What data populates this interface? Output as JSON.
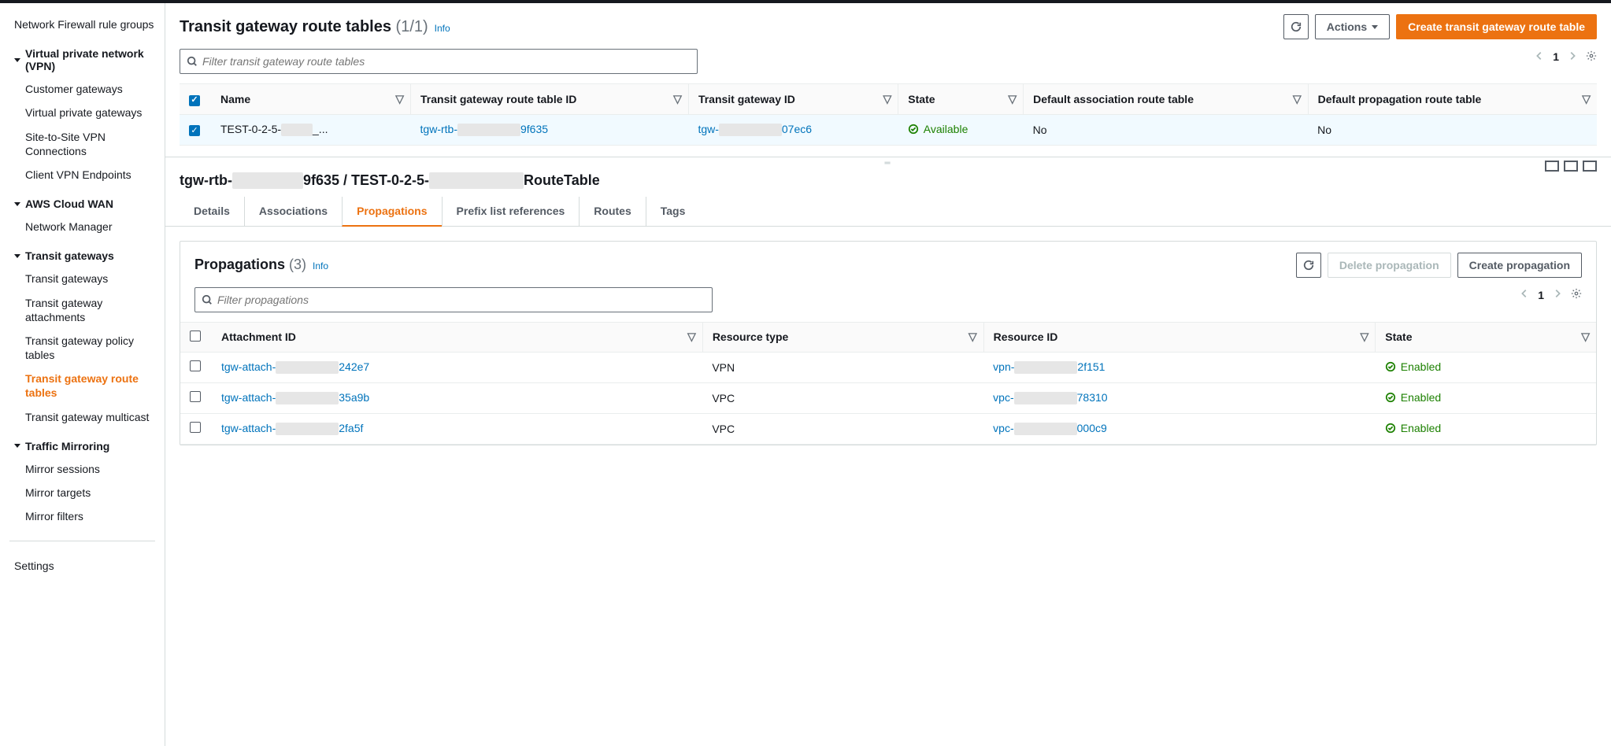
{
  "sidebar": {
    "top_items": [
      "Network Firewall rule groups"
    ],
    "groups": [
      {
        "title": "Virtual private network (VPN)",
        "items": [
          "Customer gateways",
          "Virtual private gateways",
          "Site-to-Site VPN Connections",
          "Client VPN Endpoints"
        ]
      },
      {
        "title": "AWS Cloud WAN",
        "items": [
          "Network Manager"
        ]
      },
      {
        "title": "Transit gateways",
        "items": [
          "Transit gateways",
          "Transit gateway attachments",
          "Transit gateway policy tables",
          "Transit gateway route tables",
          "Transit gateway multicast"
        ],
        "active_index": 3
      },
      {
        "title": "Traffic Mirroring",
        "items": [
          "Mirror sessions",
          "Mirror targets",
          "Mirror filters"
        ]
      }
    ],
    "footer": "Settings"
  },
  "header": {
    "title": "Transit gateway route tables",
    "count": "(1/1)",
    "info": "Info",
    "actions_label": "Actions",
    "create_label": "Create transit gateway route table",
    "filter_placeholder": "Filter transit gateway route tables",
    "page": "1"
  },
  "columns": [
    "Name",
    "Transit gateway route table ID",
    "Transit gateway ID",
    "State",
    "Default association route table",
    "Default propagation route table"
  ],
  "row": {
    "name_prefix": "TEST-0-2-5-",
    "name_suffix": "_...",
    "rtb_prefix": "tgw-rtb-",
    "rtb_suffix": "9f635",
    "tgw_prefix": "tgw-",
    "tgw_suffix": "07ec6",
    "state": "Available",
    "assoc": "No",
    "prop": "No"
  },
  "detail": {
    "breadcrumb_prefix": "tgw-rtb-",
    "breadcrumb_mid_suffix": "9f635 / TEST-0-2-5-",
    "breadcrumb_end": "RouteTable",
    "tabs": [
      "Details",
      "Associations",
      "Propagations",
      "Prefix list references",
      "Routes",
      "Tags"
    ],
    "active_tab": 2
  },
  "propagations": {
    "title": "Propagations",
    "count": "(3)",
    "info": "Info",
    "delete_label": "Delete propagation",
    "create_label": "Create propagation",
    "filter_placeholder": "Filter propagations",
    "page": "1",
    "columns": [
      "Attachment ID",
      "Resource type",
      "Resource ID",
      "State"
    ],
    "rows": [
      {
        "att_prefix": "tgw-attach-",
        "att_suffix": "242e7",
        "rtype": "VPN",
        "rid_prefix": "vpn-",
        "rid_suffix": "2f151",
        "state": "Enabled"
      },
      {
        "att_prefix": "tgw-attach-",
        "att_suffix": "35a9b",
        "rtype": "VPC",
        "rid_prefix": "vpc-",
        "rid_suffix": "78310",
        "state": "Enabled"
      },
      {
        "att_prefix": "tgw-attach-",
        "att_suffix": "2fa5f",
        "rtype": "VPC",
        "rid_prefix": "vpc-",
        "rid_suffix": "000c9",
        "state": "Enabled"
      }
    ]
  }
}
